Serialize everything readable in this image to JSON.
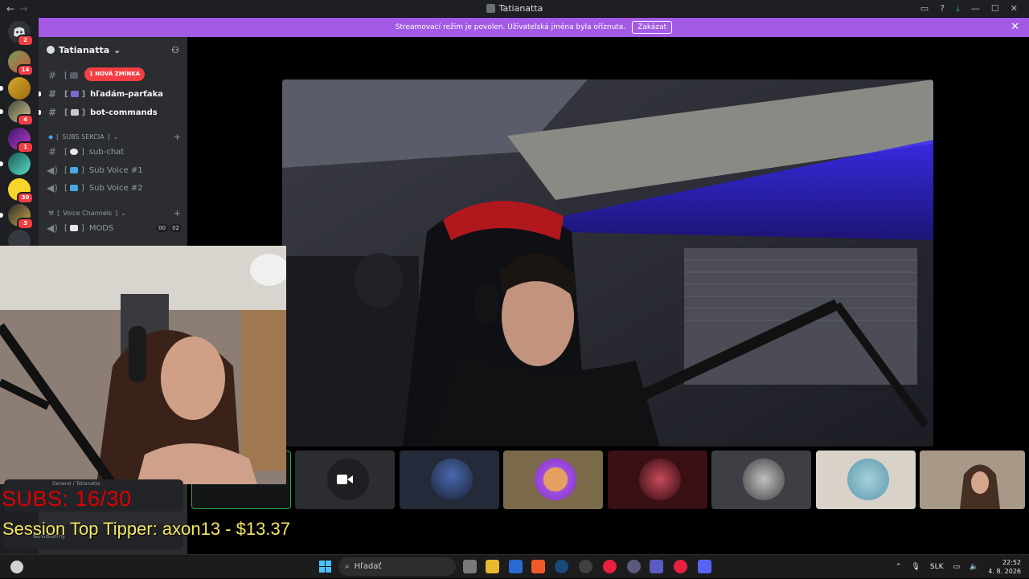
{
  "window": {
    "title": "Tatianatta",
    "nav_back": "←",
    "nav_forward": "→"
  },
  "banner": {
    "text": "Streamovací režim je povolen. Uživatelská jména byla oříznuta.",
    "button": "Zakázat",
    "close": "✕"
  },
  "guilds": [
    {
      "badge": "2"
    },
    {
      "badge": "14"
    },
    {
      "badge": ""
    },
    {
      "badge": "4"
    },
    {
      "badge": "1"
    },
    {
      "badge": ""
    },
    {
      "badge": "30"
    },
    {
      "badge": "3"
    },
    {
      "badge": ""
    }
  ],
  "server": {
    "name": "Tatianatta",
    "chevron": "⌄"
  },
  "mention_badge": "1 NOVÁ ZMÍNKA",
  "channels": [
    {
      "name": "hľadám-parťaka",
      "type": "text",
      "unread": true
    },
    {
      "name": "bot-commands",
      "type": "text",
      "unread": true
    }
  ],
  "categories": [
    {
      "name": "SUBS SEKCIA",
      "channels": [
        {
          "name": "sub-chat",
          "type": "text"
        },
        {
          "name": "Sub Voice #1",
          "type": "voice"
        },
        {
          "name": "Sub Voice #2",
          "type": "voice"
        }
      ]
    },
    {
      "name": "Voice Channels",
      "channels": [
        {
          "name": "MODS",
          "type": "voice",
          "counts": [
            "00",
            "02"
          ]
        }
      ]
    }
  ],
  "overlay": {
    "subs": "SUBS: 16/30",
    "tipper": "Session Top Tipper: axon13 - $13.37"
  },
  "voice_panel": {
    "text": "General / Tatianatta"
  },
  "user_panel": {
    "status": "Neviditeľný"
  },
  "taskbar": {
    "search": "Hľadať",
    "lang": "SLK",
    "time": "22:52",
    "date": "4. 8. 2026"
  }
}
